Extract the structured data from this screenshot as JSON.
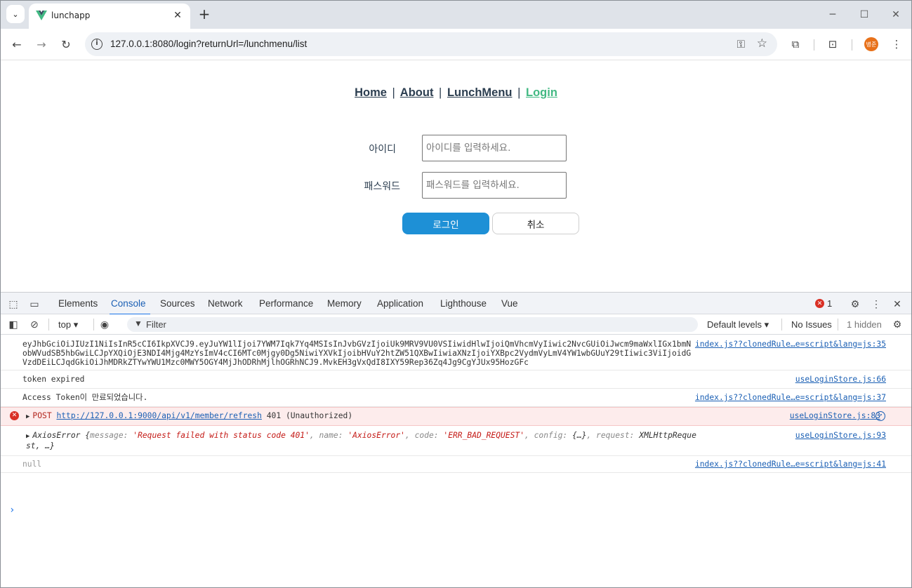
{
  "browser": {
    "tab_title": "lunchapp",
    "url": "127.0.0.1:8080/login?returnUrl=/lunchmenu/list",
    "avatar_label": "병준"
  },
  "page": {
    "nav": {
      "home": "Home",
      "about": "About",
      "lunchmenu": "LunchMenu",
      "login": "Login",
      "separator": "|"
    },
    "form": {
      "id_label": "아이디",
      "id_placeholder": "아이디를 입력하세요.",
      "password_label": "패스워드",
      "password_placeholder": "패스워드를 입력하세요.",
      "login_button": "로그인",
      "cancel_button": "취소"
    }
  },
  "devtools": {
    "tabs": [
      "Elements",
      "Console",
      "Sources",
      "Network",
      "Performance",
      "Memory",
      "Application",
      "Lighthouse",
      "Vue"
    ],
    "active_tab": "Console",
    "error_count": "1",
    "context": "top",
    "filter_placeholder": "Filter",
    "levels": "Default levels",
    "issues": "No Issues",
    "hidden": "1 hidden",
    "logs": [
      {
        "message": "eyJhbGciOiJIUzI1NiIsInR5cCI6IkpXVCJ9.eyJuYW1lIjoi7YWM7Iqk7Yq4MSIsInJvbGVzIjoiUk9MRV9VU0VSIiwidHlwIjoiQmVhcmVyIiwic2NvcGUiOiJwcm9maWxlIGx1bmNobWVudSB5hbGwiLCJpYXQiOjE3NDI4Mjg4MzYsImV4cCI6MTc0Mjgy0Dg5NiwiYXVkIjoibHVuY2htZW51QXBwIiwiaXNzIjoiYXBpc2VydmVyLmV4YW1wbGUuY29tIiwic3ViIjoidGVzdDEiLCJqdGkiOiJhMDRkZTYwYWU1Mzc0MWY5OGY4MjJhODRhMjlhOGRhNCJ9.MvkEH3gVxQdI8IXY59Rep36Zq4Jg9CgYJUx95HozGFc",
        "source": "index.js??clonedRule…e=script&lang=js:35"
      },
      {
        "message": "token expired",
        "source": "useLoginStore.js:66"
      },
      {
        "message": "Access Token이 만료되었습니다.",
        "source": "index.js??clonedRule…e=script&lang=js:37"
      },
      {
        "method": "POST",
        "url": "http://127.0.0.1:9000/api/v1/member/refresh",
        "status": "401 (Unauthorized)",
        "source": "useLoginStore.js:83"
      },
      {
        "prefix": "AxiosError {",
        "k1": "message: ",
        "v1": "'Request failed with status code 401'",
        "k2": ", name: ",
        "v2": "'AxiosError'",
        "k3": ", code: ",
        "v3": "'ERR_BAD_REQUEST'",
        "k4": ", config: ",
        "v4": "{…}",
        "k5": ", request: ",
        "v5": "XMLHttpRequest",
        "suffix": ", …}",
        "source": "useLoginStore.js:93"
      },
      {
        "message": "null",
        "source": "index.js??clonedRule…e=script&lang=js:41"
      }
    ]
  },
  "colors": {
    "accent_vue": "#42b983",
    "login_button": "#1e90d6",
    "error": "#d93025"
  }
}
